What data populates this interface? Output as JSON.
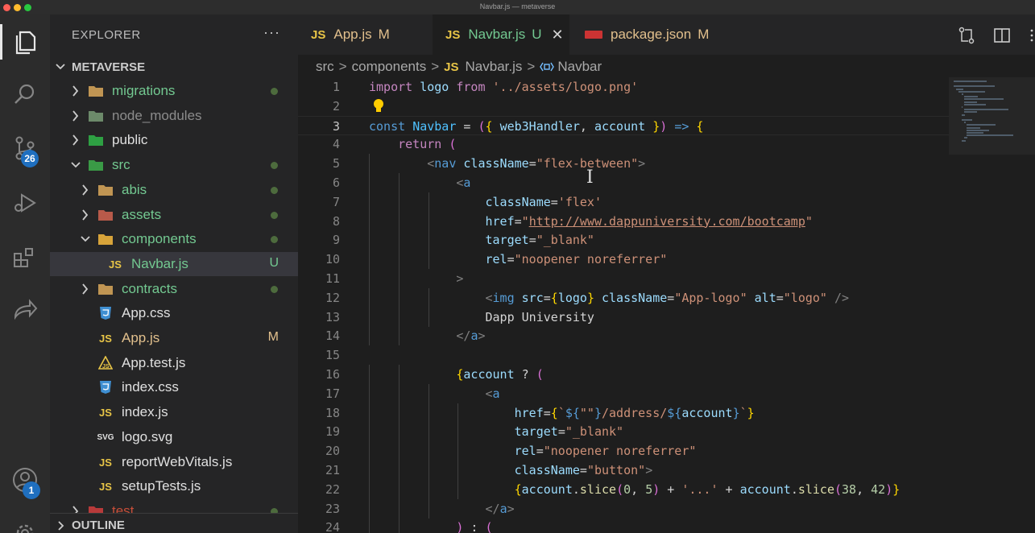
{
  "window": {
    "title": "Navbar.js — metaverse"
  },
  "activity": {
    "scm_badge": "26",
    "account_badge": "1"
  },
  "explorer": {
    "heading": "EXPLORER",
    "more": "···",
    "project": "METAVERSE",
    "outline": "OUTLINE",
    "tree": [
      {
        "name": "migrations",
        "color": "#73c991",
        "icon": "folder-icon"
      },
      {
        "name": "node_modules",
        "color": "#8c8c8c",
        "icon": "node-folder-icon"
      },
      {
        "name": "public",
        "color": "#e0e0e0",
        "icon": "public-folder-icon"
      },
      {
        "name": "src",
        "color": "#73c991",
        "icon": "src-folder-icon"
      },
      {
        "name": "abis",
        "color": "#73c991",
        "icon": "folder-icon"
      },
      {
        "name": "assets",
        "color": "#73c991",
        "icon": "assets-folder-icon"
      },
      {
        "name": "components",
        "color": "#73c991",
        "icon": "components-folder-icon"
      },
      {
        "name": "Navbar.js",
        "color": "#73c991",
        "icon": "js-file-icon",
        "status": "U"
      },
      {
        "name": "contracts",
        "color": "#73c991",
        "icon": "folder-icon"
      },
      {
        "name": "App.css",
        "color": "#e0e0e0",
        "icon": "css-file-icon"
      },
      {
        "name": "App.js",
        "color": "#e2c08d",
        "icon": "js-file-icon",
        "status": "M"
      },
      {
        "name": "App.test.js",
        "color": "#e0e0e0",
        "icon": "test-file-icon"
      },
      {
        "name": "index.css",
        "color": "#e0e0e0",
        "icon": "css-file-icon"
      },
      {
        "name": "index.js",
        "color": "#e0e0e0",
        "icon": "js-file-icon"
      },
      {
        "name": "logo.svg",
        "color": "#e0e0e0",
        "icon": "svg-file-icon"
      },
      {
        "name": "reportWebVitals.js",
        "color": "#e0e0e0",
        "icon": "js-file-icon"
      },
      {
        "name": "setupTests.js",
        "color": "#e0e0e0",
        "icon": "js-file-icon"
      },
      {
        "name": "test",
        "color": "#c74e39",
        "icon": "test-folder-icon"
      }
    ]
  },
  "tabs": [
    {
      "icon": "JS",
      "label": "App.js",
      "status": "M",
      "color": "#e2c08d"
    },
    {
      "icon": "JS",
      "label": "Navbar.js",
      "status": "U",
      "color": "#73c991",
      "close": "✕"
    },
    {
      "icon": "package-json-icon",
      "label": "package.json",
      "status": "M",
      "color": "#e2c08d"
    }
  ],
  "breadcrumb": {
    "p1": "src",
    "p2": "components",
    "js": "JS",
    "p3": "Navbar.js",
    "p4": "Navbar",
    "sep": ">"
  },
  "code_lines": [
    "import logo from '../assets/logo.png'",
    "",
    "const Navbar = ({ web3Handler, account }) => {",
    "    return (",
    "        <nav className=\"flex-between\">",
    "            <a",
    "                className='flex'",
    "                href=\"http://www.dappuniversity.com/bootcamp\"",
    "                target=\"_blank\"",
    "                rel=\"noopener noreferrer\"",
    "            >",
    "                <img src={logo} className=\"App-logo\" alt=\"logo\" />",
    "                Dapp University",
    "            </a>",
    "",
    "            {account ? (",
    "                <a",
    "                    href={`${\"\"}/address/${account}`}",
    "                    target=\"_blank\"",
    "                    rel=\"noopener noreferrer\"",
    "                    className=\"button\">",
    "                    {account.slice(0, 5) + '...' + account.slice(38, 42)}",
    "                </a>",
    "            ) : ("
  ],
  "line_numbers": [
    "1",
    "2",
    "3",
    "4",
    "5",
    "6",
    "7",
    "8",
    "9",
    "10",
    "11",
    "12",
    "13",
    "14",
    "15",
    "16",
    "17",
    "18",
    "19",
    "20",
    "21",
    "22",
    "23",
    "24"
  ],
  "current_line": "3"
}
